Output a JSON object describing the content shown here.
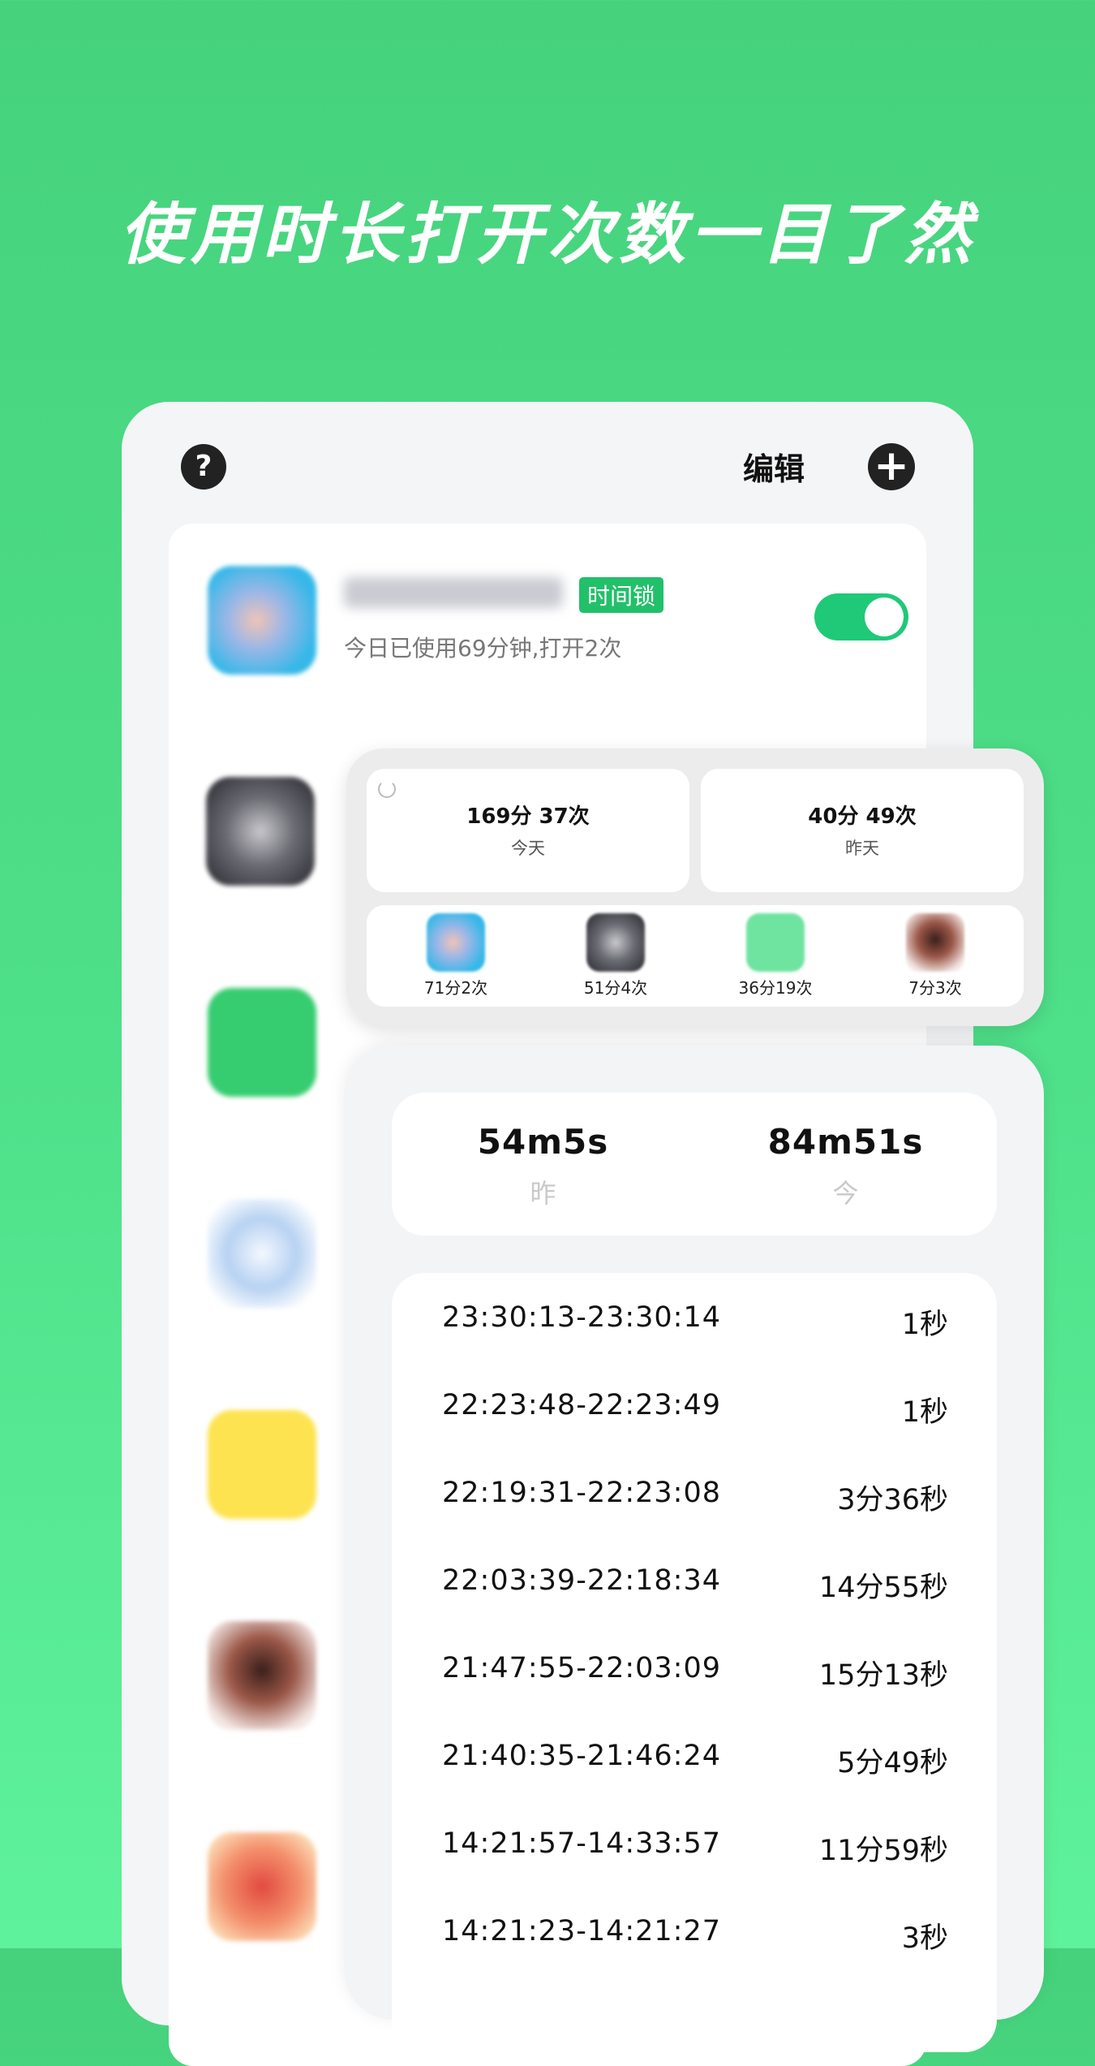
{
  "headline": "使用时长打开次数一目了然",
  "phone": {
    "help_icon": "?",
    "edit_label": "编辑",
    "add_icon": "+",
    "first_item": {
      "tag": "时间锁",
      "usage": "今日已使用69分钟,打开2次",
      "toggle_on": true
    }
  },
  "widget": {
    "today": {
      "value": "169分 37次",
      "label": "今天"
    },
    "yesterday": {
      "value": "40分 49次",
      "label": "昨天"
    },
    "apps": [
      {
        "label": "71分2次"
      },
      {
        "label": "51分4次"
      },
      {
        "label": "36分19次"
      },
      {
        "label": "7分3次"
      }
    ]
  },
  "detail": {
    "yesterday": {
      "value": "54m5s",
      "label": "昨"
    },
    "today": {
      "value": "84m51s",
      "label": "今"
    },
    "sessions": [
      {
        "range": "23:30:13-23:30:14",
        "duration": "1秒"
      },
      {
        "range": "22:23:48-22:23:49",
        "duration": "1秒"
      },
      {
        "range": "22:19:31-22:23:08",
        "duration": "3分36秒"
      },
      {
        "range": "22:03:39-22:18:34",
        "duration": "14分55秒"
      },
      {
        "range": "21:47:55-22:03:09",
        "duration": "15分13秒"
      },
      {
        "range": "21:40:35-21:46:24",
        "duration": "5分49秒"
      },
      {
        "range": "14:21:57-14:33:57",
        "duration": "11分59秒"
      },
      {
        "range": "14:21:23-14:21:27",
        "duration": "3秒"
      }
    ]
  }
}
